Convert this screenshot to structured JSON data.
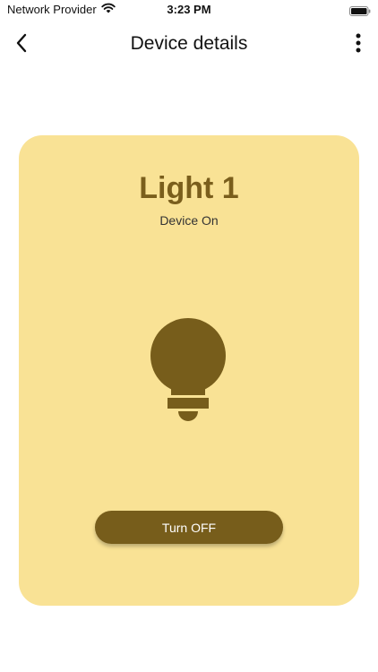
{
  "status_bar": {
    "carrier": "Network Provider",
    "time": "3:23 PM",
    "wifi_icon": "wifi-icon",
    "battery_icon": "battery-icon"
  },
  "nav": {
    "title": "Device details",
    "back_icon": "chevron-left-icon",
    "menu_icon": "more-vertical-icon"
  },
  "device": {
    "name": "Light 1",
    "status": "Device On",
    "icon": "lightbulb-icon",
    "toggle_label": "Turn OFF"
  },
  "colors": {
    "card_background": "#f9e295",
    "accent": "#775d1b",
    "title_color": "#7a5e1c"
  }
}
